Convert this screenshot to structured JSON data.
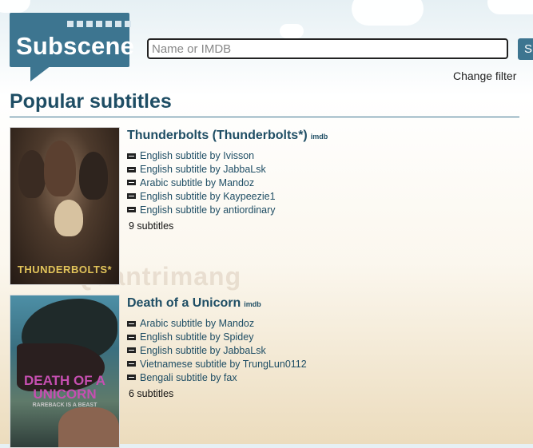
{
  "site": {
    "logo_text": "Subscene"
  },
  "search": {
    "placeholder": "Name or IMDB",
    "button_label": "S"
  },
  "filter": {
    "label": "Change filter"
  },
  "page": {
    "title": "Popular subtitles"
  },
  "movies": [
    {
      "title": "Thunderbolts (Thunderbolts*)",
      "imdb_label": "imdb",
      "poster_text": "THUNDERBOLTS*",
      "subtitles": [
        "English subtitle by Ivisson",
        "English subtitle by JabbaLsk",
        "Arabic subtitle by Mandoz",
        "English subtitle by Kaypeezie1",
        "English subtitle by antiordinary"
      ],
      "count": "9 subtitles"
    },
    {
      "title": "Death of a Unicorn",
      "imdb_label": "imdb",
      "poster_text": "DEATH OF A UNICORN",
      "poster_tagline": "RAREBACK IS A BEAST",
      "subtitles": [
        "Arabic subtitle by Mandoz",
        "English subtitle by Spidey",
        "English subtitle by JabbaLsk",
        "Vietnamese subtitle by TrungLun0112",
        "Bengali subtitle by fax"
      ],
      "count": "6 subtitles"
    }
  ],
  "watermark": "Quantrimang",
  "colors": {
    "brand": "#3d7590",
    "heading": "#1e4d64"
  }
}
